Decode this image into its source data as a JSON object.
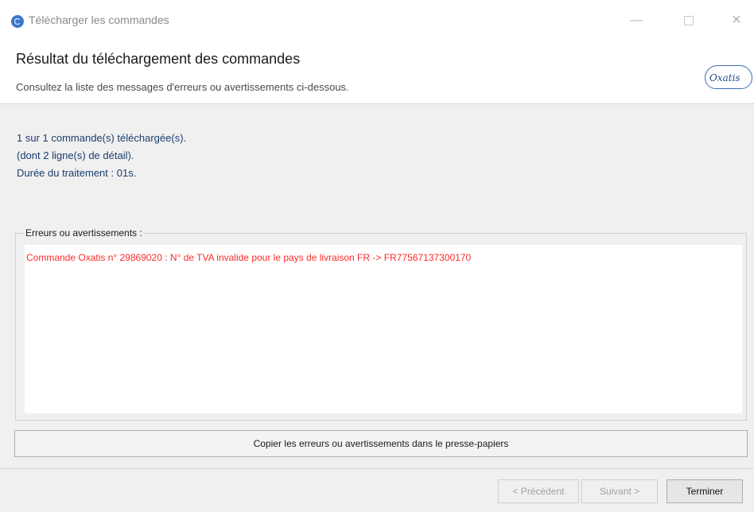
{
  "window": {
    "title": "Télécharger les commandes",
    "minimize_glyph": "—",
    "close_glyph": "✕"
  },
  "header": {
    "title": "Résultat du téléchargement des commandes",
    "subtitle": "Consultez la liste des messages d'erreurs ou avertissements ci-dessous.",
    "logo_text": "Oxatis"
  },
  "summary": {
    "line1": "1 sur 1 commande(s) téléchargée(s).",
    "line2": "(dont 2 ligne(s) de détail).",
    "line3": "Durée du traitement : 01s."
  },
  "errors": {
    "group_label": "Erreurs ou avertissements :",
    "messages": [
      "Commande Oxatis n° 29869020 : N° de TVA invalide pour le pays de livraison FR -> FR77567137300170"
    ]
  },
  "buttons": {
    "copy": "Copier les erreurs ou avertissements dans le presse-papiers",
    "previous": "< Précédent",
    "next": "Suivant >",
    "finish": "Terminer"
  },
  "colors": {
    "error_text": "#ff2a2a",
    "summary_text": "#1a3d6e",
    "logo_border": "#3f6fb5",
    "app_icon": "#3a78c9"
  }
}
